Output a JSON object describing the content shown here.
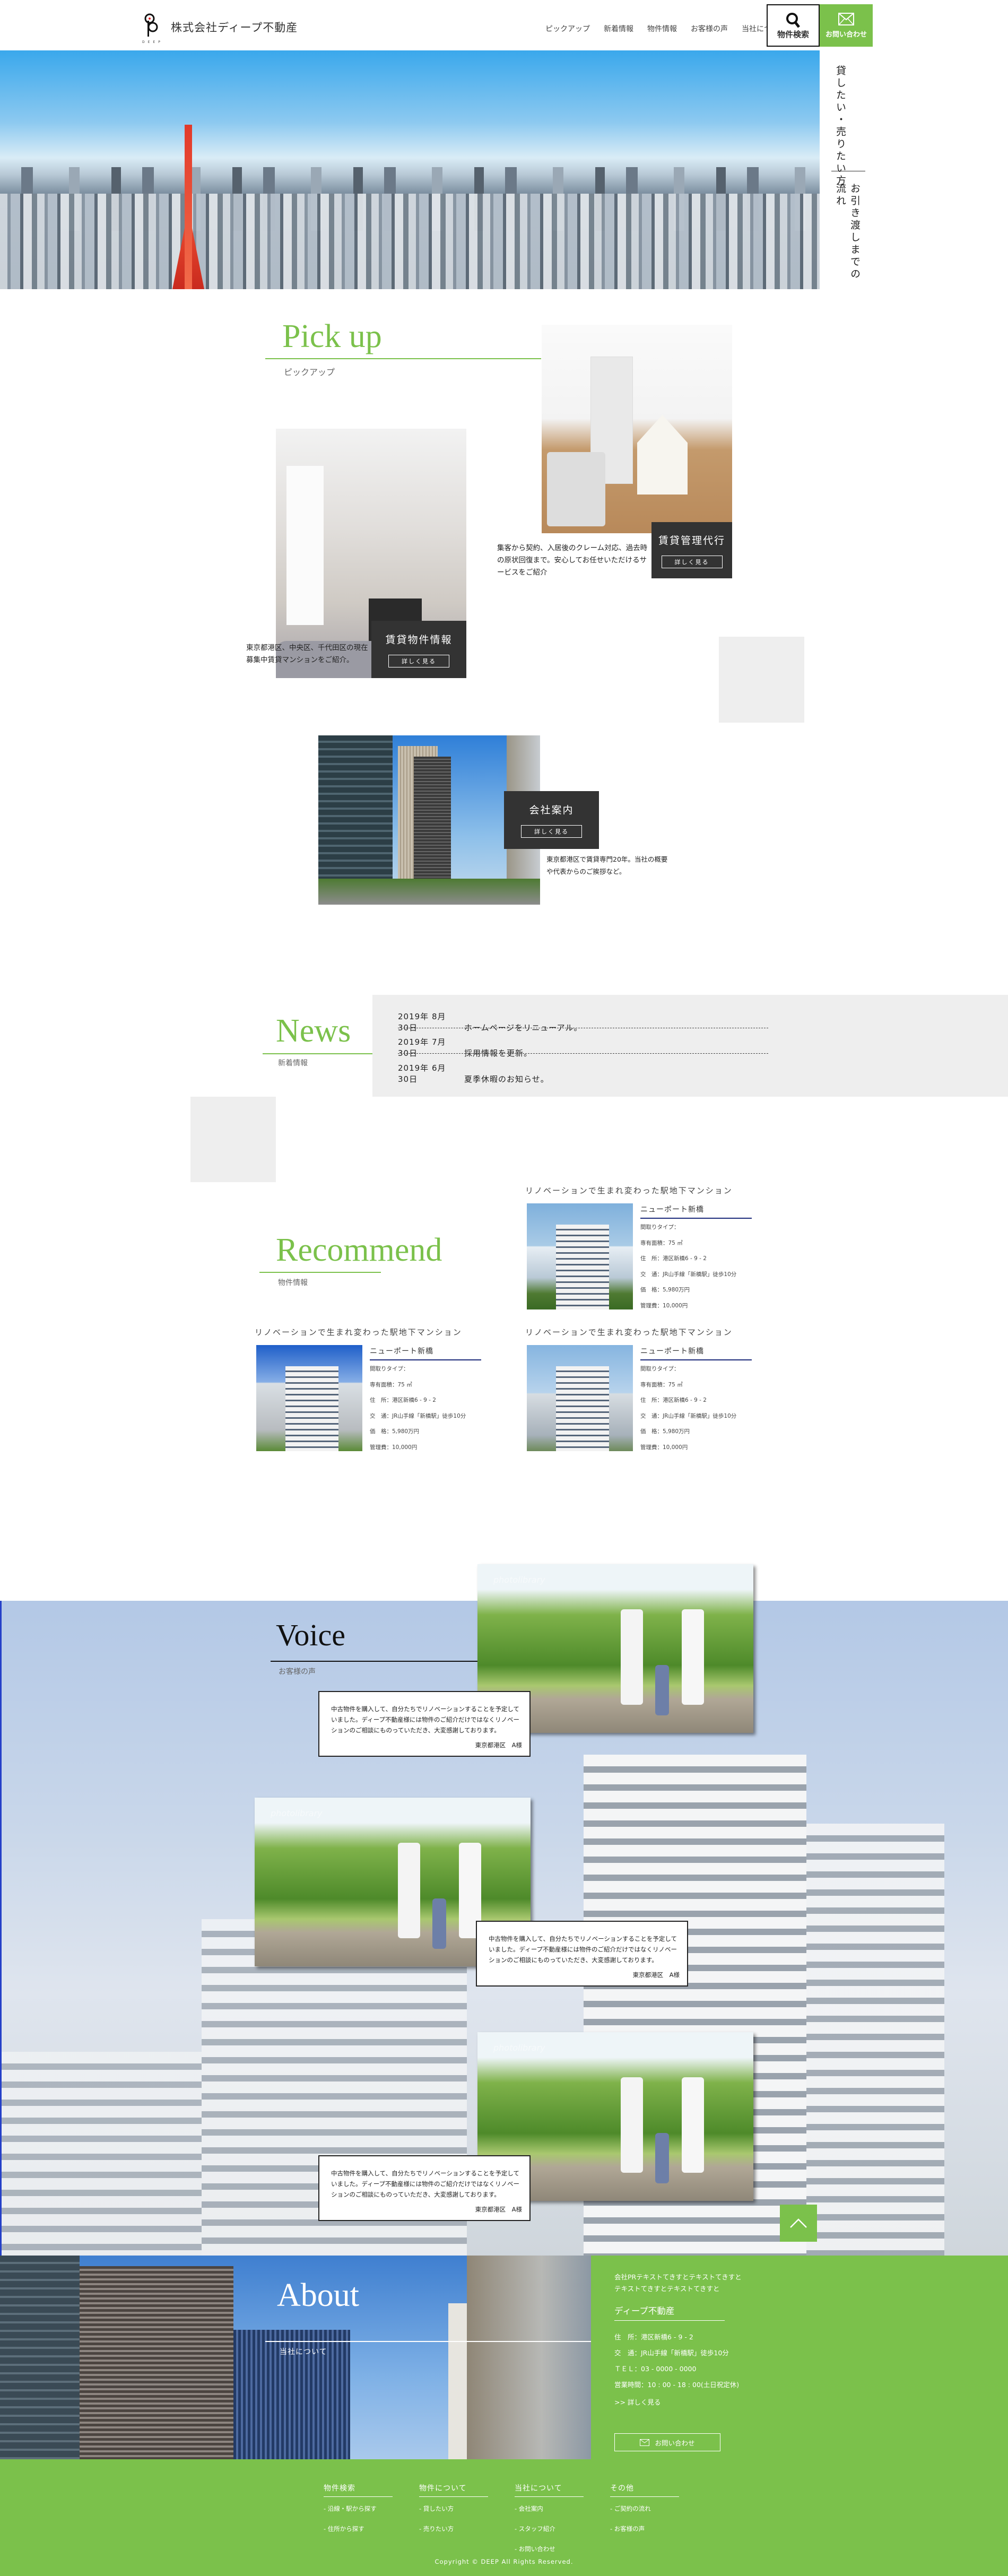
{
  "colors": {
    "accent": "#7bc14b",
    "dark_box": "#333333",
    "panel_gray": "#eeeeee",
    "rec_rule": "#1c2a7a"
  },
  "header": {
    "logo_text": "株式会社ディープ不動産",
    "logo_sub": "DEEP",
    "nav": [
      "ピックアップ",
      "新着情報",
      "物件情報",
      "お客様の声",
      "当社について"
    ],
    "search_button": "物件検索",
    "search_icon": "search-icon",
    "contact_button": "お問い合わせ",
    "contact_icon": "mail-icon"
  },
  "side_tab": {
    "item1": "貸したい・売りたい方",
    "item2": "お引き渡しまでの流れ"
  },
  "pickup": {
    "title": "Pick up",
    "subtitle": "ピックアップ",
    "cards": [
      {
        "title": "賃貸管理代行",
        "button": "詳しく見る",
        "text": "集客から契約、入居後のクレーム対応、過去時の原状回復まで。安心してお任せいただけるサービスをご紹介"
      },
      {
        "title": "賃貸物件情報",
        "button": "詳しく見る",
        "text": "東京都港区、中央区、千代田区の現在募集中賃貸マンションをご紹介。"
      },
      {
        "title": "会社案内",
        "button": "詳しく見る",
        "text": "東京都港区で賃貸専門20年。当社の概要や代表からのご挨拶など。"
      }
    ]
  },
  "news": {
    "title": "News",
    "subtitle": "新着情報",
    "items": [
      {
        "date": "2019年 8月30日",
        "text": "ホームページをリニューアル。"
      },
      {
        "date": "2019年 7月30日",
        "text": "採用情報を更新。"
      },
      {
        "date": "2019年 6月30日",
        "text": "夏季休暇のお知らせ。"
      }
    ]
  },
  "recommend": {
    "title": "Recommend",
    "subtitle": "物件情報",
    "items": [
      {
        "title": "リノベーションで生まれ変わった駅地下マンション",
        "name": "ニューポート新橋",
        "fields": [
          "間取りタイプ：",
          "専有面積：75 ㎡",
          "住　所：港区新橋6 - 9 - 2",
          "交　通：JR山手線「新橋駅」徒歩10分",
          "価　格：5,980万円",
          "管理費：10,000円"
        ]
      },
      {
        "title": "リノベーションで生まれ変わった駅地下マンション",
        "name": "ニューポート新橋",
        "fields": [
          "間取りタイプ：",
          "専有面積：75 ㎡",
          "住　所：港区新橋6 - 9 - 2",
          "交　通：JR山手線「新橋駅」徒歩10分",
          "価　格：5,980万円",
          "管理費：10,000円"
        ]
      },
      {
        "title": "リノベーションで生まれ変わった駅地下マンション",
        "name": "ニューポート新橋",
        "fields": [
          "間取りタイプ：",
          "専有面積：75 ㎡",
          "住　所：港区新橋6 - 9 - 2",
          "交　通：JR山手線「新橋駅」徒歩10分",
          "価　格：5,980万円",
          "管理費：10,000円"
        ]
      }
    ]
  },
  "voice": {
    "title": "Voice",
    "subtitle": "お客様の声",
    "items": [
      {
        "text": "中古物件を購入して、自分たちでリノベーションすることを予定していました。ディープ不動産様には物件のご紹介だけではなくリノベーションのご相談にものっていただき、大変感謝しております。",
        "name": "東京都港区　A様"
      },
      {
        "text": "中古物件を購入して、自分たちでリノベーションすることを予定していました。ディープ不動産様には物件のご紹介だけではなくリノベーションのご相談にものっていただき、大変感謝しております。",
        "name": "東京都港区　A様"
      },
      {
        "text": "中古物件を購入して、自分たちでリノベーションすることを予定していました。ディープ不動産様には物件のご紹介だけではなくリノベーションのご相談にものっていただき、大変感謝しております。",
        "name": "東京都港区　A様"
      }
    ],
    "watermark": "photolibrary"
  },
  "about": {
    "title": "About",
    "subtitle": "当社について",
    "pr_line1": "会社PRテキストてきすとテキストてきすと",
    "pr_line2": "テキストてきすとテキストてきすと",
    "company": "ディープ不動産",
    "address": "住　所：港区新橋6 - 9 - 2",
    "access": "交　通：JR山手線「新橋駅」徒歩10分",
    "tel": "ＴＥＬ：03 - 0000 - 0000",
    "hours": "営業時間：10 : 00 - 18 : 00(土日祝定休)",
    "more": ">>  詳しく見る",
    "contact_button": "お問い合わせ"
  },
  "footer": {
    "columns": [
      {
        "heading": "物件検索",
        "links": [
          "- 沿線・駅から探す",
          "- 住所から探す"
        ]
      },
      {
        "heading": "物件について",
        "links": [
          "- 貸したい方",
          "- 売りたい方"
        ]
      },
      {
        "heading": "当社について",
        "links": [
          "- 会社案内",
          "- スタッフ紹介",
          "- お問い合わせ"
        ]
      },
      {
        "heading": "その他",
        "links": [
          "- ご契約の流れ",
          "- お客様の声"
        ]
      }
    ],
    "copyright": "Copyright © DEEP All Rights Reserved."
  }
}
